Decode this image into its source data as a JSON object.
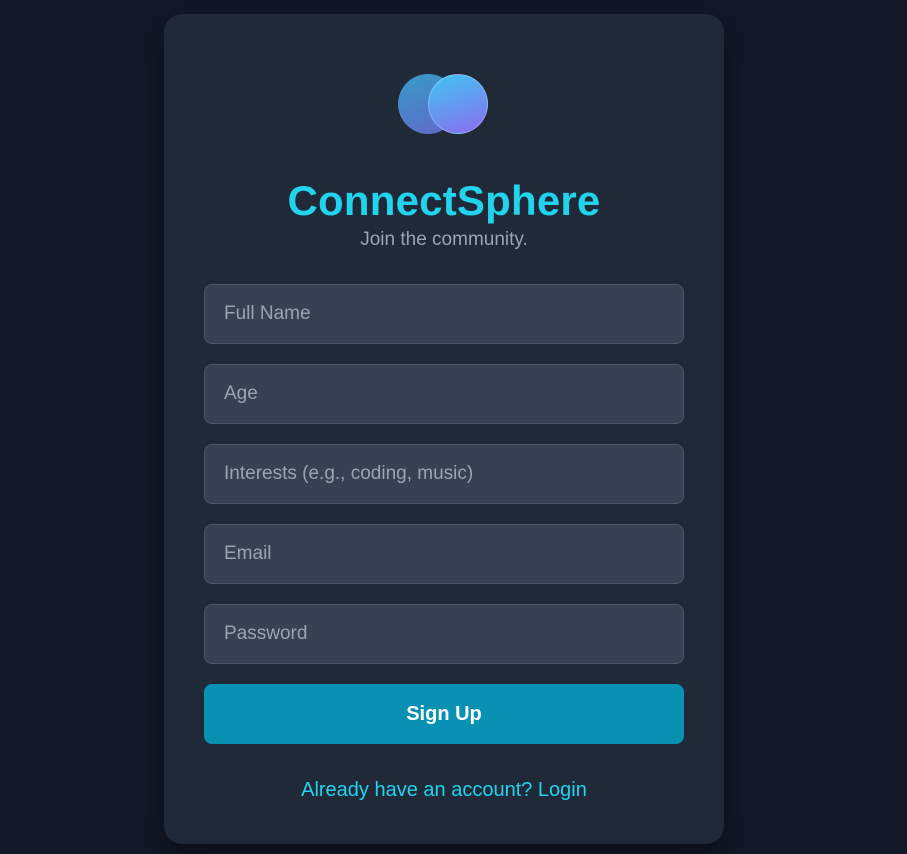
{
  "brand": {
    "name": "ConnectSphere",
    "tagline": "Join the community.",
    "accent_color": "#22d3ee"
  },
  "form": {
    "fields": [
      {
        "placeholder": "Full Name",
        "value": ""
      },
      {
        "placeholder": "Age",
        "value": ""
      },
      {
        "placeholder": "Interests (e.g., coding, music)",
        "value": ""
      },
      {
        "placeholder": "Email",
        "value": ""
      },
      {
        "placeholder": "Password",
        "value": ""
      }
    ],
    "submit_label": "Sign Up",
    "submit_color": "#0891b2"
  },
  "footer": {
    "login_link": "Already have an account? Login"
  },
  "colors": {
    "page_background": "#111827",
    "card_background": "#1f2937",
    "field_background": "#374151"
  }
}
